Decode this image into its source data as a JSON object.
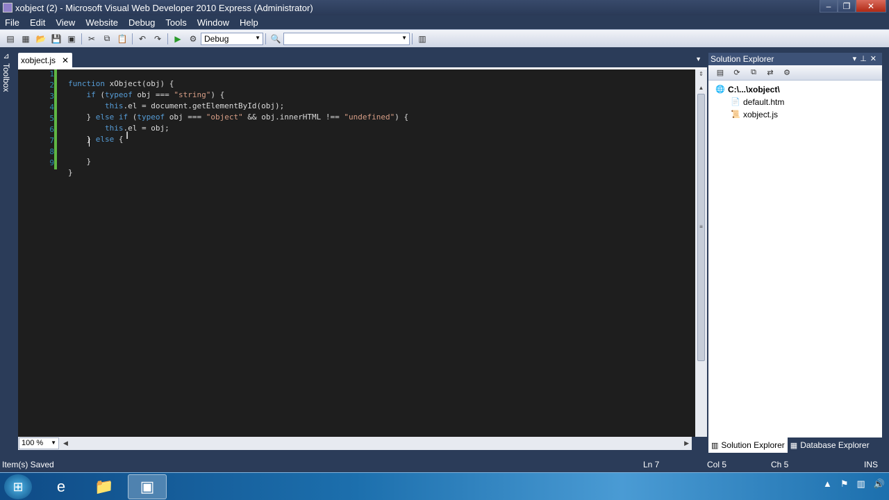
{
  "window": {
    "title": "xobject (2) - Microsoft Visual Web Developer 2010 Express (Administrator)",
    "min": "–",
    "max": "❐",
    "close": "✕"
  },
  "menu": [
    "File",
    "Edit",
    "View",
    "Website",
    "Debug",
    "Tools",
    "Window",
    "Help"
  ],
  "toolbar": {
    "config": "Debug",
    "find_value": ""
  },
  "toolbox_label": "Toolbox",
  "doc_tab": {
    "label": "xobject.js",
    "close": "✕"
  },
  "code": {
    "line_numbers": [
      "1",
      "2",
      "3",
      "4",
      "5",
      "6",
      "7",
      "8",
      "9"
    ]
  },
  "zoom": "100 %",
  "solution_explorer": {
    "title": "Solution Explorer",
    "root": "C:\\...\\xobject\\",
    "files": [
      "default.htm",
      "xobject.js"
    ]
  },
  "bottom_tabs": [
    "Solution Explorer",
    "Database Explorer"
  ],
  "status": {
    "message": "Item(s) Saved",
    "ln": "Ln 7",
    "col": "Col 5",
    "ch": "Ch 5",
    "mode": "INS"
  },
  "colors": {
    "editor_bg": "#1e1e1e",
    "keyword": "#569cd6",
    "string": "#d69d85",
    "chrome": "#2b3c59",
    "change_bar": "#5fb643"
  }
}
